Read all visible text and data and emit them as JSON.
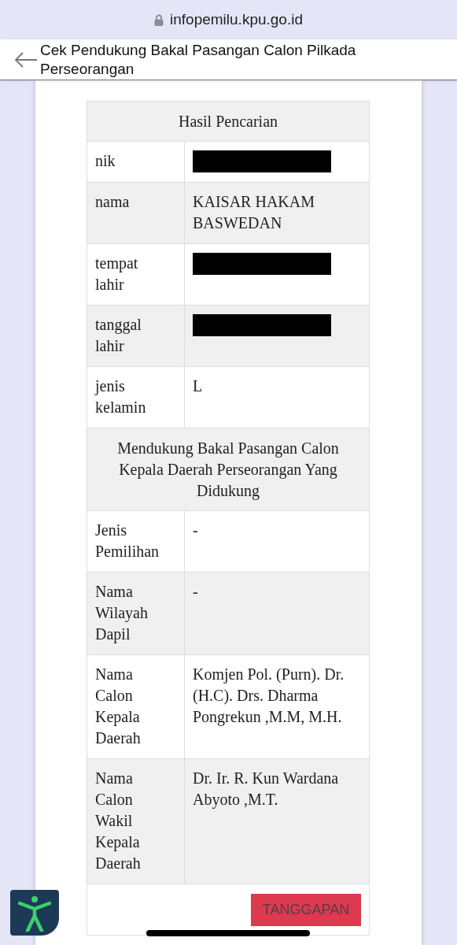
{
  "address_bar": {
    "url": "infopemilu.kpu.go.id"
  },
  "header": {
    "title": "Cek Pendukung Bakal Pasangan Calon Pilkada Perseorangan"
  },
  "table": {
    "sections": [
      {
        "title": "Hasil Pencarian",
        "rows": [
          {
            "label": "nik",
            "redacted": true
          },
          {
            "label": "nama",
            "value": "KAISAR HAKAM BASWEDAN"
          },
          {
            "label": "tempat lahir",
            "redacted": true
          },
          {
            "label": "tanggal lahir",
            "redacted": true
          },
          {
            "label": "jenis kelamin",
            "value": "L"
          }
        ]
      },
      {
        "title": "Mendukung Bakal Pasangan Calon Kepala Daerah Perseorangan Yang Didukung",
        "rows": [
          {
            "label": "Jenis Pemilihan",
            "value": "-"
          },
          {
            "label": "Nama Wilayah Dapil",
            "value": "-"
          },
          {
            "label": "Nama Calon Kepala Daerah",
            "value": "Komjen Pol. (Purn). Dr. (H.C). Drs. Dharma Pongrekun ,M.M, M.H."
          },
          {
            "label": "Nama Calon Wakil Kepala Daerah",
            "value": "Dr. Ir. R. Kun Wardana Abyoto ,M.T."
          }
        ]
      }
    ]
  },
  "button": "TANGGAPAN"
}
